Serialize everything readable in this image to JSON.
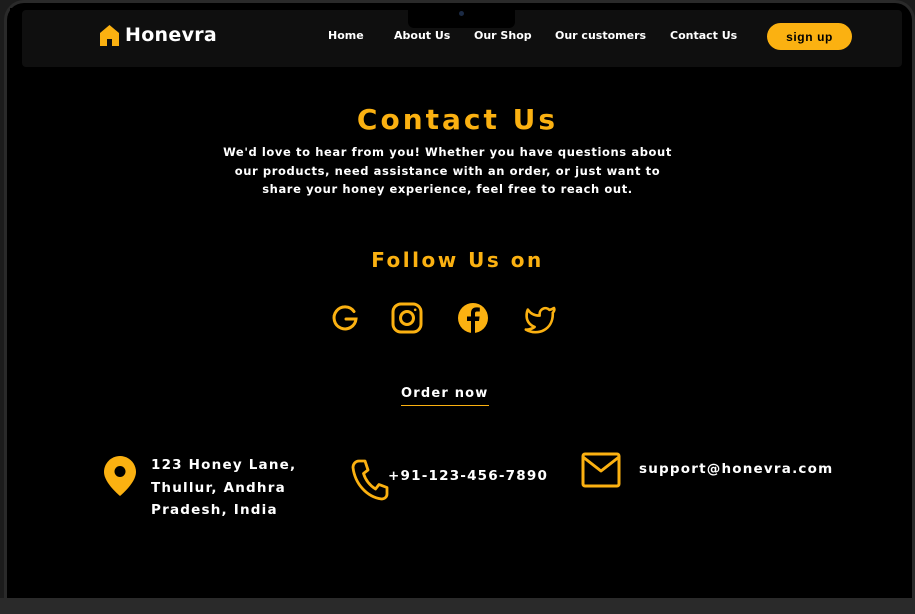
{
  "brand": {
    "name": "Honevra"
  },
  "nav": {
    "links": [
      "Home",
      "About Us",
      "Our Shop",
      "Our customers",
      "Contact Us"
    ],
    "signup_label": "sign up"
  },
  "contact": {
    "title": "Contact Us",
    "intro": "We'd love to hear from you! Whether you have questions about our products, need assistance with an order, or just want to share your honey experience, feel free to reach out."
  },
  "follow": {
    "title": "Follow Us on",
    "icons": [
      "google-icon",
      "instagram-icon",
      "facebook-icon",
      "twitter-icon"
    ]
  },
  "order": {
    "label": "Order now"
  },
  "details": {
    "address": "123 Honey Lane, Thullur, Andhra Pradesh, India",
    "phone": "+91-123-456-7890",
    "email": "support@honevra.com"
  },
  "colors": {
    "accent": "#fbb111",
    "background": "#000000",
    "text": "#ffffff"
  }
}
